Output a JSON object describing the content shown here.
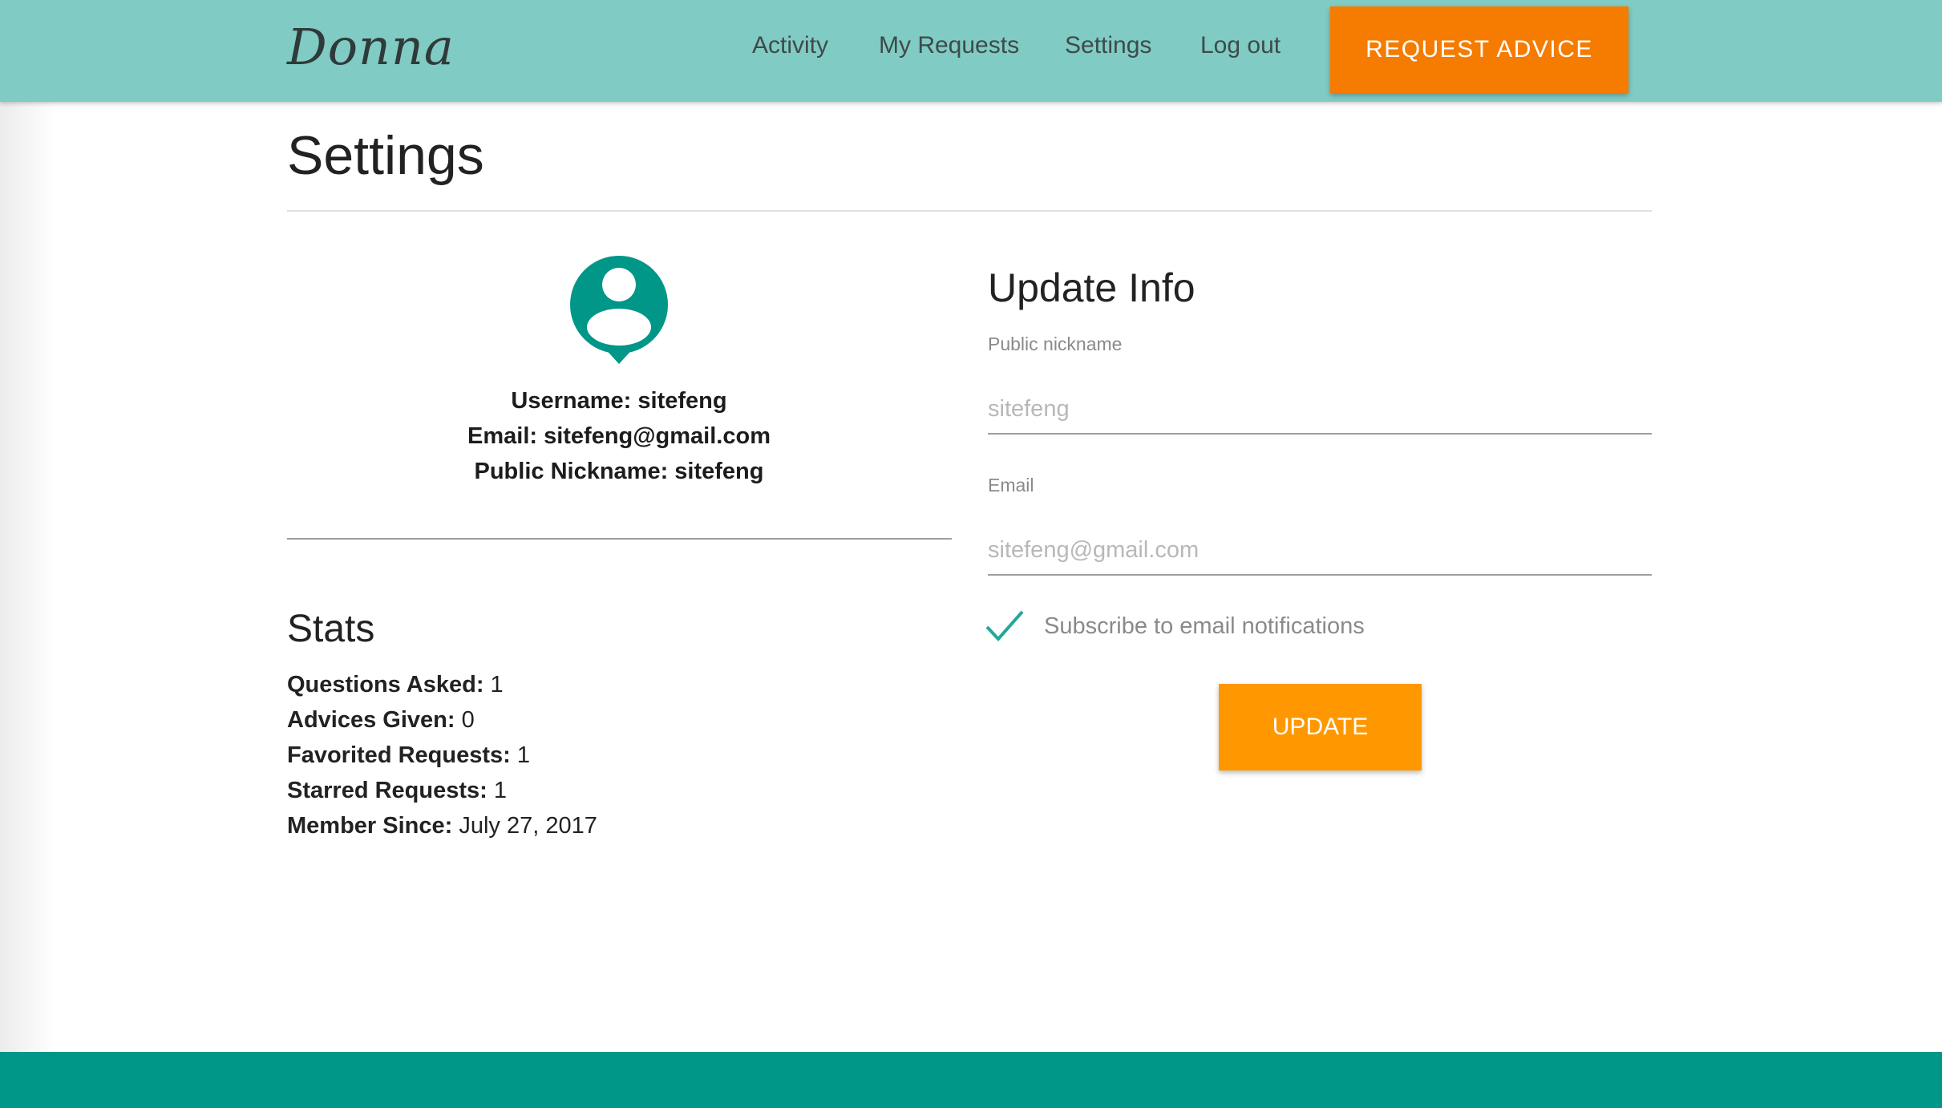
{
  "brand": {
    "logo_text": "Donna"
  },
  "nav": {
    "items": [
      {
        "label": "Activity"
      },
      {
        "label": "My Requests"
      },
      {
        "label": "Settings"
      },
      {
        "label": "Log out"
      }
    ],
    "cta_label": "REQUEST ADVICE"
  },
  "page": {
    "title": "Settings"
  },
  "profile": {
    "avatar_icon": "account-pin-icon",
    "username_line": "Username: sitefeng",
    "email_line": "Email: sitefeng@gmail.com",
    "nickname_line": "Public Nickname: sitefeng"
  },
  "stats": {
    "title": "Stats",
    "items": [
      {
        "label": "Questions Asked:",
        "value": "1"
      },
      {
        "label": "Advices Given:",
        "value": "0"
      },
      {
        "label": "Favorited Requests:",
        "value": "1"
      },
      {
        "label": "Starred Requests:",
        "value": "1"
      },
      {
        "label": "Member Since:",
        "value": "July 27, 2017"
      }
    ]
  },
  "update_info": {
    "title": "Update Info",
    "nickname_label": "Public nickname",
    "nickname_placeholder": "sitefeng",
    "email_label": "Email",
    "email_placeholder": "sitefeng@gmail.com",
    "subscribe_label": "Subscribe to email notifications",
    "subscribe_checked": true,
    "update_label": "UPDATE"
  },
  "colors": {
    "header": "#80cbc4",
    "primary": "#009688",
    "accent_orange": "#f57c00",
    "update_orange": "#ff9800",
    "footer": "#009688"
  }
}
